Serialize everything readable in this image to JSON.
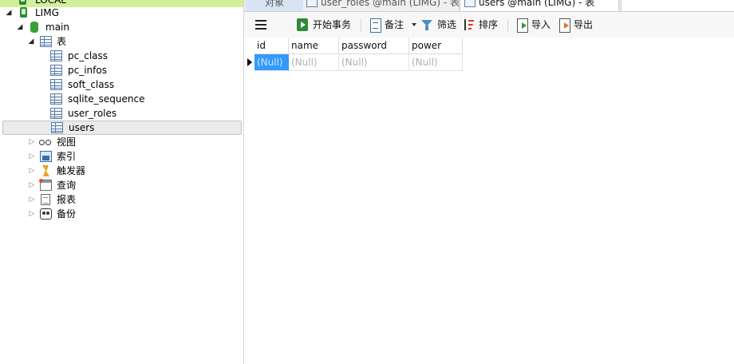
{
  "tree": {
    "partial_top_label": "LOCAL",
    "db_label": "LIMG",
    "schema_label": "main",
    "tables_group_label": "表",
    "tables": [
      "pc_class",
      "pc_infos",
      "soft_class",
      "sqlite_sequence",
      "user_roles",
      "users"
    ],
    "selected_table": "users",
    "groups": [
      "视图",
      "索引",
      "触发器",
      "查询",
      "报表",
      "备份"
    ]
  },
  "tabs": {
    "objects": "对象",
    "user_roles": "user_roles @main (LIMG) - 表",
    "users": "users @main (LIMG) - 表"
  },
  "toolbar": {
    "begin_transaction": "开始事务",
    "memo": "备注",
    "filter": "筛选",
    "sort": "排序",
    "import": "导入",
    "export": "导出"
  },
  "grid": {
    "columns": [
      "id",
      "name",
      "password",
      "power"
    ],
    "rows": [
      [
        "(Null)",
        "(Null)",
        "(Null)",
        "(Null)"
      ]
    ]
  },
  "colors": {
    "selected_cell": "#3399ff",
    "partial_row_bg": "#d2ef9b",
    "tab_objects_bg": "#d7e4f3"
  }
}
